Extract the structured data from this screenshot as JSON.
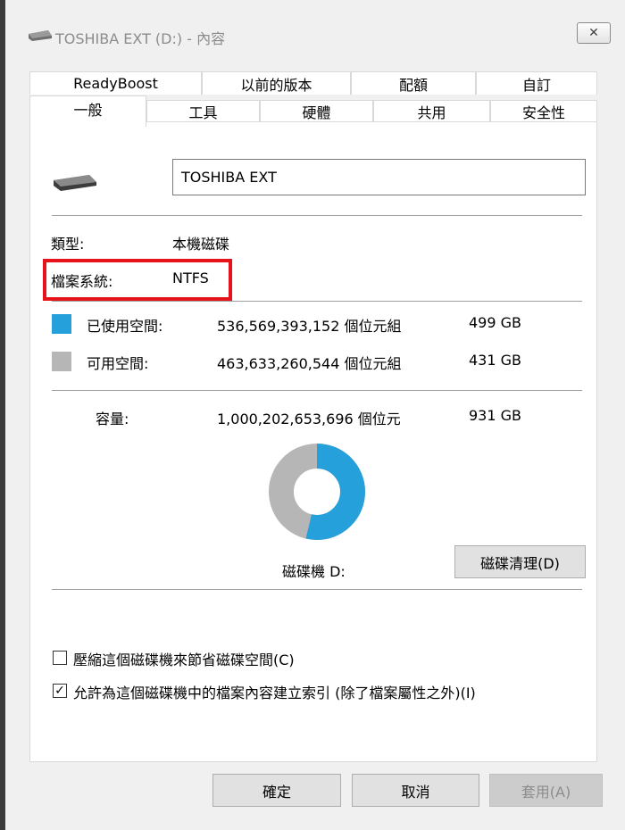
{
  "window": {
    "title": "TOSHIBA EXT (D:) - 內容",
    "close_label": "✕"
  },
  "tabs_back": [
    "ReadyBoost",
    "以前的版本",
    "配額",
    "自訂"
  ],
  "tabs_front": [
    "一般",
    "工具",
    "硬體",
    "共用",
    "安全性"
  ],
  "general": {
    "drive_name": "TOSHIBA EXT",
    "type_label": "類型:",
    "type_value": "本機磁碟",
    "fs_label": "檔案系統:",
    "fs_value": "NTFS",
    "used_label": "已使用空間:",
    "used_bytes": "536,569,393,152 個位元組",
    "used_size": "499 GB",
    "free_label": "可用空間:",
    "free_bytes": "463,633,260,544 個位元組",
    "free_size": "431 GB",
    "cap_label": "容量:",
    "cap_bytes": "1,000,202,653,696 個位元",
    "cap_size": "931 GB",
    "drive_label": "磁碟機 D:",
    "cleanup_label": "磁碟清理(D)",
    "compress_label": "壓縮這個磁碟機來節省磁碟空間(C)",
    "compress_checked": false,
    "index_label": "允許為這個磁碟機中的檔案內容建立索引 (除了檔案屬性之外)(I)",
    "index_checked": true
  },
  "colors": {
    "used": "#26a0da",
    "free": "#b6b6b6",
    "highlight": "#e6131b"
  },
  "usage": {
    "used_fraction": 0.5364,
    "free_fraction": 0.4636
  },
  "footer": {
    "ok": "確定",
    "cancel": "取消",
    "apply": "套用(A)"
  }
}
